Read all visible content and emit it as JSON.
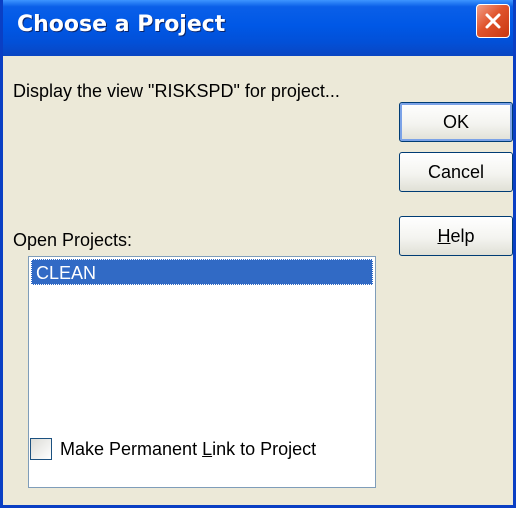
{
  "dialog": {
    "title": "Choose a Project",
    "close_icon": "close-icon",
    "message": "Display the view \"RISKSPD\" for project...",
    "buttons": {
      "ok": "OK",
      "cancel": "Cancel",
      "help": {
        "mnemonic": "H",
        "rest": "elp"
      }
    },
    "open_projects_label": "Open Projects:",
    "projects": [
      {
        "name": "CLEAN",
        "selected": true
      }
    ],
    "permanent_link": {
      "pre": "Make Permanent ",
      "mnemonic": "L",
      "post": "ink to Project",
      "checked": false
    }
  },
  "colors": {
    "titlebar": "#0058e6",
    "selection": "#316ac5",
    "close_button": "#e0542c",
    "dialog_bg": "#ece9d8"
  }
}
